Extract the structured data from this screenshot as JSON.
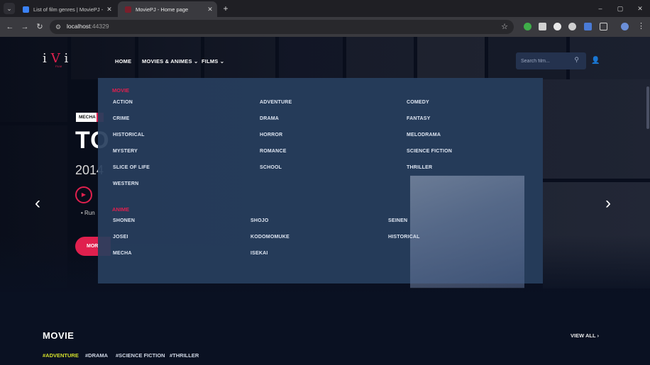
{
  "browser": {
    "tabs": [
      {
        "title": "List of film genres | MoviePJ - A",
        "active": false
      },
      {
        "title": "MoviePJ - Home page",
        "active": true
      }
    ],
    "new_tab_symbol": "+",
    "url_host": "localhost",
    "url_port": ":44329",
    "window_controls": [
      "–",
      "▢",
      "✕"
    ]
  },
  "header": {
    "logo": {
      "mark_left": "i",
      "mark_mid": "V",
      "mark_right": "i",
      "sub": "FILM"
    },
    "nav": [
      {
        "label": "HOME"
      },
      {
        "label": "MOVIES & ANIMES"
      },
      {
        "label": "FILMS"
      }
    ],
    "search": {
      "placeholder": "Search film..."
    }
  },
  "hero": {
    "tag": "MECHA",
    "title": "TO",
    "year": "2014",
    "bullet": "Run",
    "more_label": "MOR"
  },
  "mega_menu": {
    "movie_heading": "MOVIE",
    "movie_genres": [
      [
        "ACTION",
        "ADVENTURE",
        "COMEDY"
      ],
      [
        "CRIME",
        "DRAMA",
        "FANTASY"
      ],
      [
        "HISTORICAL",
        "HORROR",
        "MELODRAMA"
      ],
      [
        "MYSTERY",
        "ROMANCE",
        "SCIENCE FICTION"
      ],
      [
        "SLICE OF LIFE",
        "SCHOOL",
        "THRILLER"
      ],
      [
        "WESTERN"
      ]
    ],
    "anime_heading": "ANIME",
    "anime_genres": [
      [
        "SHONEN",
        "SHOJO",
        "SEINEN"
      ],
      [
        "JOSEI",
        "KODOMOMUKE",
        "HISTORICAL"
      ],
      [
        "MECHA",
        "ISEKAI"
      ]
    ]
  },
  "movie_section": {
    "title": "MOVIE",
    "view_all": "VIEW ALL",
    "tags": [
      {
        "label": "#ADVENTURE",
        "active": true
      },
      {
        "label": "#DRAMA",
        "active": false
      },
      {
        "label": "#SCIENCE FICTION",
        "active": false
      },
      {
        "label": "#THRILLER",
        "active": false
      }
    ]
  },
  "colors": {
    "accent": "#e0204e",
    "active_tag": "#d4e02a",
    "menu_bg": "#283e5e"
  }
}
